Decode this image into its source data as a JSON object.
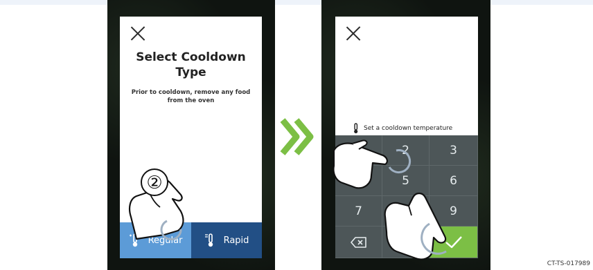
{
  "left_screen": {
    "title_line1": "Select Cooldown",
    "title_line2": "Type",
    "subtitle": "Prior to cooldown, remove any food from the oven",
    "step_number": "②",
    "buttons": {
      "regular": "Regular",
      "rapid": "Rapid"
    }
  },
  "right_screen": {
    "hint": "Set a cooldown temperature",
    "keys": [
      "",
      "2",
      "3",
      "",
      "5",
      "6",
      "7",
      "",
      "9",
      "",
      "",
      ""
    ]
  },
  "figure_code": "CT-TS-017989",
  "colors": {
    "regular": "#5c9bd7",
    "rapid": "#224f85",
    "keypad": "#4d5658",
    "confirm": "#7cbf45",
    "arrow": "#7cbf45"
  }
}
